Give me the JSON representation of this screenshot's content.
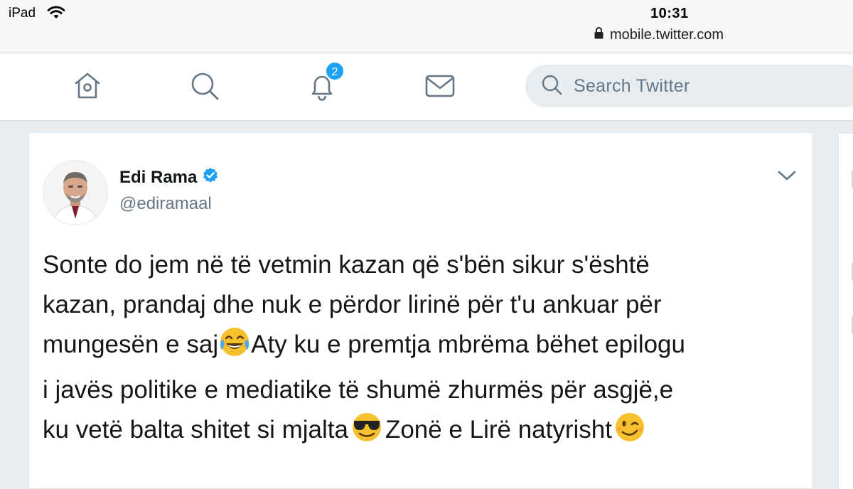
{
  "status_bar": {
    "device": "iPad",
    "time": "10:31",
    "url": "mobile.twitter.com"
  },
  "nav": {
    "icons": [
      "home-icon",
      "search-icon",
      "notifications-bell-icon",
      "messages-envelope-icon"
    ],
    "notifications_count": "2",
    "search_placeholder": "Search Twitter"
  },
  "tweet": {
    "author_name": "Edi Rama",
    "handle": "@ediramaal",
    "verified": true,
    "lines": [
      "Sonte do jem në të vetmin kazan që s'bën sikur s'është",
      "kazan, prandaj dhe nuk e përdor lirinë për t'u ankuar për",
      "mungesën e saj",
      "Aty ku e premtja mbrëma bëhet epilogu",
      "i javës politike e mediatike të shumë zhurmës për asgjë,e",
      "ku vetë balta shitet si mjalta",
      "Zonë e Lirë natyrisht"
    ],
    "emojis": [
      "tears-of-joy-emoji",
      "sunglasses-emoji",
      "wink-emoji"
    ]
  },
  "colors": {
    "accent": "#1da1f2",
    "background": "#e6ecf0",
    "text": "#14171a",
    "secondary_text": "#657786",
    "icon": "#657786"
  }
}
